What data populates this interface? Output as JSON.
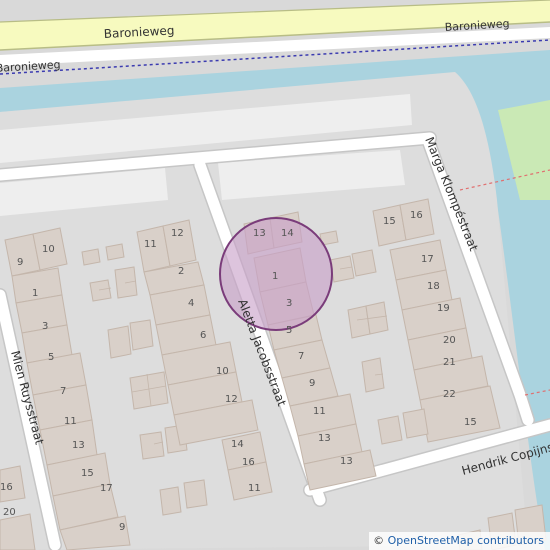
{
  "colors": {
    "background": "#d9d9d9",
    "water": "#aad3df",
    "main_road": "#f7fabf",
    "main_road_casing": "#b8bd86",
    "street": "#ffffff",
    "street_casing": "#c6c6c6",
    "building": "#d9d0c9",
    "building_outline": "#c4b6ab",
    "grass": "#cdebb0",
    "marker_fill": "#c8a0c8",
    "marker_stroke": "#7a3c7a",
    "rail": "#3b3bb0",
    "boundary": "#e07070"
  },
  "roads": {
    "baronieweg_main": "Baronieweg",
    "baronieweg_service": "Baronieweg",
    "baronieweg_track": "Baronieweg",
    "aletta": "Aletta Jacobsstraat",
    "marga": "Marga Klompéstraat",
    "mien": "Mien Ruysstraat",
    "hendrik": "Hendrik Copijnstr"
  },
  "house_numbers": {
    "left_block": [
      "9",
      "10",
      "1",
      "3",
      "5",
      "7",
      "11",
      "13",
      "15",
      "16",
      "17",
      "9",
      "20"
    ],
    "middle_block": [
      "11",
      "12",
      "2",
      "4",
      "6",
      "10",
      "12",
      "14",
      "16",
      "11"
    ],
    "right_block": [
      "13",
      "14",
      "1",
      "3",
      "5",
      "7",
      "9",
      "11",
      "13",
      "13",
      "15",
      "16",
      "17",
      "18",
      "19",
      "20",
      "21",
      "22",
      "15"
    ]
  },
  "attribution": {
    "copyright": "©",
    "text": "OpenStreetMap contributors"
  }
}
